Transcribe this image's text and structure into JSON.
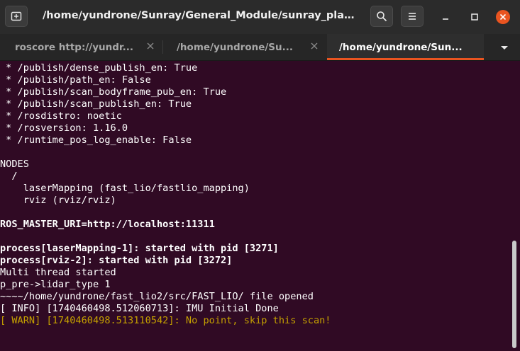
{
  "window": {
    "title": "/home/yundrone/Sunray/General_Module/sunray_planner/U..."
  },
  "tabs": [
    {
      "label": "roscore http://yundr...",
      "active": false
    },
    {
      "label": "/home/yundrone/Su...",
      "active": false
    },
    {
      "label": "/home/yundrone/Sun...",
      "active": true
    }
  ],
  "icons": {
    "new_tab": "new-tab-icon",
    "search": "search-icon",
    "menu": "hamburger-menu-icon",
    "minimize": "minimize-icon",
    "maximize": "maximize-icon",
    "close": "close-icon",
    "tab_close": "tab-close-icon",
    "tabs_dropdown": "chevron-down-icon"
  },
  "colors": {
    "terminal_bg": "#300a24",
    "close_button": "#e95420",
    "active_tab_underline": "#e95420",
    "warn_text": "#c4a000"
  },
  "terminal": {
    "lines": [
      " * /publish/dense_publish_en: True",
      " * /publish/path_en: False",
      " * /publish/scan_bodyframe_pub_en: True",
      " * /publish/scan_publish_en: True",
      " * /rosdistro: noetic",
      " * /rosversion: 1.16.0",
      " * /runtime_pos_log_enable: False",
      "",
      "NODES",
      "  /",
      "    laserMapping (fast_lio/fastlio_mapping)",
      "    rviz (rviz/rviz)",
      "",
      "ROS_MASTER_URI=http://localhost:11311",
      "",
      "process[laserMapping-1]: started with pid [3271]",
      "process[rviz-2]: started with pid [3272]",
      "Multi thread started",
      "p_pre->lidar_type 1",
      "~~~~/home/yundrone/fast_lio2/src/FAST_LIO/ file opened",
      "[ INFO] [1740460498.512060713]: IMU Initial Done",
      "[ WARN] [1740460498.513110542]: No point, skip this scan!"
    ]
  }
}
